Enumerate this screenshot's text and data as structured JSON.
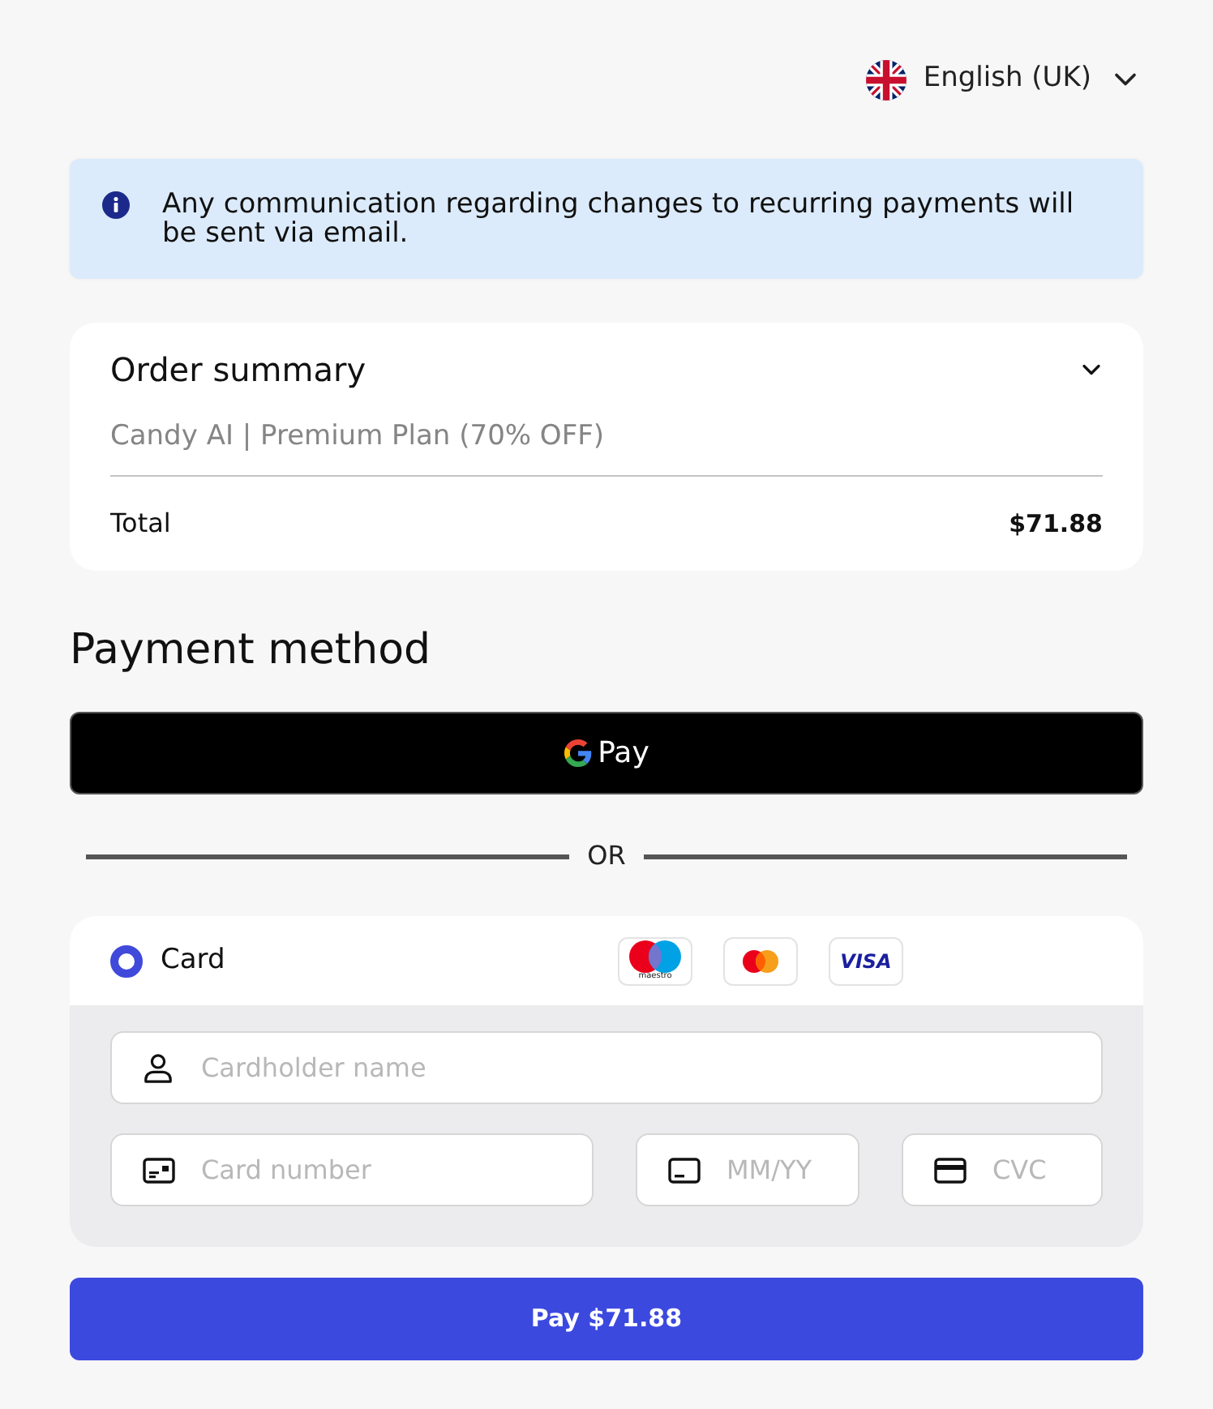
{
  "language_selector": {
    "label": "English (UK)"
  },
  "notice": {
    "kind": "info",
    "text": "Any communication regarding changes to recurring payments will be sent via email."
  },
  "order_summary": {
    "title": "Order summary",
    "items": [
      {
        "name": "Candy AI | Premium Plan (70% OFF)"
      }
    ],
    "total_label": "Total",
    "total_value": "$71.88"
  },
  "payment": {
    "heading": "Payment method",
    "wallet_button": {
      "label": "Pay"
    },
    "separator": "OR",
    "methods": [
      {
        "label": "Card",
        "selected": true,
        "brands": [
          {
            "kind": "maestro",
            "label": "maestro"
          },
          {
            "kind": "mastercard"
          },
          {
            "kind": "visa",
            "label": "VISA"
          }
        ]
      }
    ],
    "fields": [
      {
        "kind": "name",
        "placeholder": "Cardholder name"
      },
      {
        "kind": "number",
        "placeholder": "Card number"
      },
      {
        "kind": "expiry",
        "placeholder": "MM/YY"
      },
      {
        "kind": "cvc",
        "placeholder": "CVC"
      }
    ]
  },
  "pay_button": {
    "label": "Pay $71.88"
  }
}
